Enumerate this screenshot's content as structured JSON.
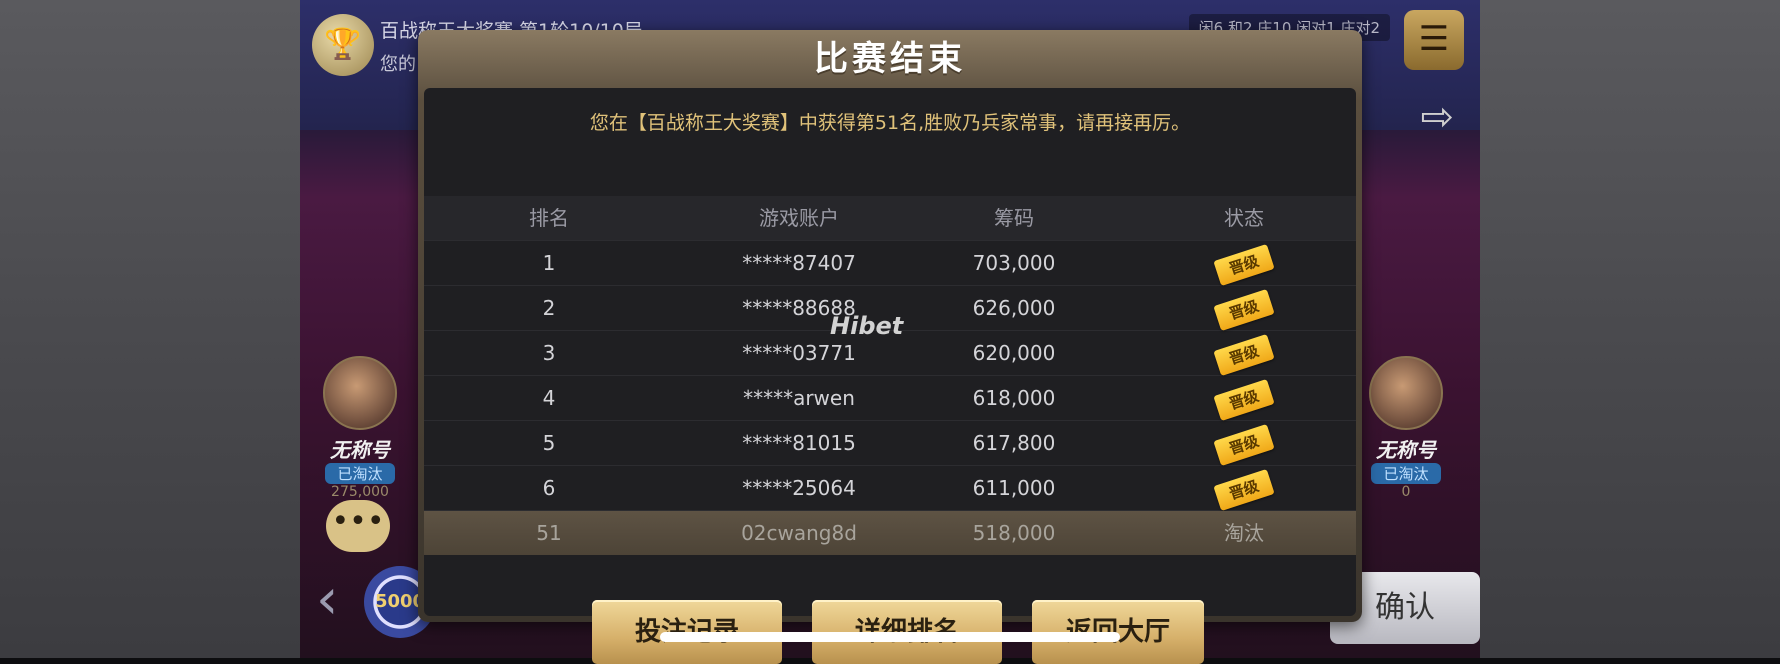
{
  "topbar": {
    "title": "百战称王大奖赛 第1轮10/10局",
    "subtitle": "您的",
    "stats": "闲6 和2 庄10 闲对1 庄对2"
  },
  "players": {
    "left": {
      "name": "无称号",
      "status": "已淘汰",
      "chips": "275,000"
    },
    "right": {
      "name": "无称号",
      "status": "已淘汰",
      "chips": "0",
      "seat": "1"
    }
  },
  "bottom": {
    "chip_value": "5000",
    "confirm_label": "确认"
  },
  "modal": {
    "title": "比赛结束",
    "message": "您在【百战称王大奖赛】中获得第51名,胜败乃兵家常事，请再接再厉。",
    "headers": [
      "排名",
      "游戏账户",
      "筹码",
      "状态"
    ],
    "rows": [
      {
        "rank": "1",
        "account": "*****87407",
        "chips": "703,000",
        "status": "晋级"
      },
      {
        "rank": "2",
        "account": "*****88688",
        "chips": "626,000",
        "status": "晋级"
      },
      {
        "rank": "3",
        "account": "*****03771",
        "chips": "620,000",
        "status": "晋级"
      },
      {
        "rank": "4",
        "account": "*****arwen",
        "chips": "618,000",
        "status": "晋级"
      },
      {
        "rank": "5",
        "account": "*****81015",
        "chips": "617,800",
        "status": "晋级"
      },
      {
        "rank": "6",
        "account": "*****25064",
        "chips": "611,000",
        "status": "晋级"
      }
    ],
    "mine": {
      "rank": "51",
      "account": "02cwang8d",
      "chips": "518,000",
      "status": "淘汰"
    },
    "buttons": {
      "history": "投注记录",
      "ranking": "详细排名",
      "lobby": "返回大厅"
    }
  },
  "watermark": "Hibet",
  "colors": {
    "gold": "#e0c27a",
    "badge": "#f0a818",
    "modal_bg": "#1f1f22"
  }
}
